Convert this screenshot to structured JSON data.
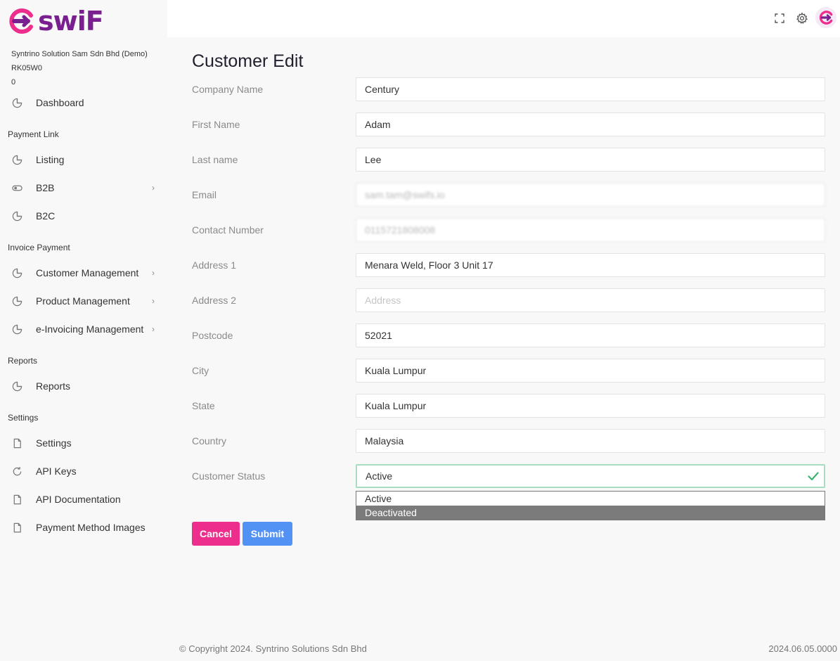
{
  "brand": {
    "name": "swiF",
    "color": "#7a1f8f"
  },
  "org": {
    "company": "Syntrino Solution Sam Sdn Bhd (Demo)",
    "code": "RK05W0",
    "balance": "0"
  },
  "sidebar": {
    "dashboard": "Dashboard",
    "sections": {
      "payment_link": "Payment Link",
      "invoice_payment": "Invoice Payment",
      "reports": "Reports",
      "settings": "Settings"
    },
    "items": {
      "listing": "Listing",
      "b2b": "B2B",
      "b2c": "B2C",
      "customer_management": "Customer Management",
      "product_management": "Product Management",
      "einvoicing": "e-Invoicing Management",
      "reports": "Reports",
      "settings": "Settings",
      "api_keys": "API Keys",
      "api_docs": "API Documentation",
      "payment_method_images": "Payment Method Images"
    },
    "chevron": "›"
  },
  "page": {
    "title": "Customer Edit"
  },
  "form": {
    "company_name": {
      "label": "Company Name",
      "value": "Century"
    },
    "first_name": {
      "label": "First Name",
      "value": "Adam"
    },
    "last_name": {
      "label": "Last name",
      "value": "Lee"
    },
    "email": {
      "label": "Email",
      "value": "sam.tam@swifs.io"
    },
    "contact": {
      "label": "Contact Number",
      "value": "0115721808008"
    },
    "address1": {
      "label": "Address 1",
      "value": "Menara Weld, Floor 3 Unit 17"
    },
    "address2": {
      "label": "Address 2",
      "value": "",
      "placeholder": "Address"
    },
    "postcode": {
      "label": "Postcode",
      "value": "52021"
    },
    "city": {
      "label": "City",
      "value": "Kuala Lumpur"
    },
    "state": {
      "label": "State",
      "value": "Kuala Lumpur"
    },
    "country": {
      "label": "Country",
      "value": "Malaysia"
    },
    "status": {
      "label": "Customer Status",
      "value": "Active",
      "options": [
        "Active",
        "Deactivated"
      ]
    }
  },
  "buttons": {
    "cancel": "Cancel",
    "submit": "Submit"
  },
  "footer": {
    "copyright": "© Copyright 2024. Syntrino Solutions Sdn Bhd",
    "version": "2024.06.05.0000"
  },
  "colors": {
    "cancel": "#ee2e8c",
    "submit": "#5392f5",
    "valid": "#3cb371"
  }
}
